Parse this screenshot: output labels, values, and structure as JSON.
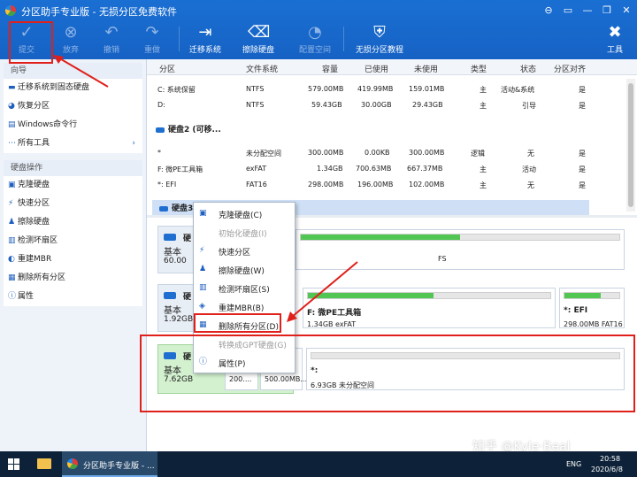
{
  "window": {
    "title": "分区助手专业版 - 无损分区免费软件",
    "controls": [
      "⊖",
      "▭",
      "—",
      "❐",
      "✕"
    ]
  },
  "toolbar": [
    {
      "label": "提交",
      "icon": "check-icon",
      "glyph": "✓",
      "enabled": false
    },
    {
      "label": "放弃",
      "icon": "discard-icon",
      "glyph": "⊗",
      "enabled": false
    },
    {
      "label": "撤销",
      "icon": "undo-icon",
      "glyph": "↶",
      "enabled": false
    },
    {
      "label": "重做",
      "icon": "redo-icon",
      "glyph": "↷",
      "enabled": false
    },
    {
      "label": "迁移系统",
      "icon": "migrate-icon",
      "glyph": "⇥",
      "enabled": true
    },
    {
      "label": "擦除硬盘",
      "icon": "wipe-disk-icon",
      "glyph": "⌫",
      "enabled": true
    },
    {
      "label": "配置空间",
      "icon": "allocate-space-icon",
      "glyph": "◔",
      "enabled": false
    },
    {
      "label": "无损分区教程",
      "icon": "shield-icon",
      "glyph": "⛨",
      "enabled": true
    },
    {
      "label": "工具",
      "icon": "tools-icon",
      "glyph": "✖",
      "enabled": true
    }
  ],
  "sidebar": {
    "wizard_header": "向导",
    "wizard_items": [
      {
        "label": "迁移系统到固态硬盘",
        "icon": "migrate-ssd-icon",
        "glyph": "▬"
      },
      {
        "label": "恢复分区",
        "icon": "recover-partition-icon",
        "glyph": "◕"
      },
      {
        "label": "Windows命令行",
        "icon": "cmd-icon",
        "glyph": "▤"
      },
      {
        "label": "所有工具",
        "icon": "more-icon",
        "glyph": "⋯"
      }
    ],
    "disk_ops_header": "硬盘操作",
    "disk_ops_items": [
      {
        "label": "克隆硬盘",
        "icon": "clone-disk-icon",
        "glyph": "▣"
      },
      {
        "label": "快速分区",
        "icon": "quick-partition-icon",
        "glyph": "⚡"
      },
      {
        "label": "擦除硬盘",
        "icon": "wipe-disk-icon",
        "glyph": "♟"
      },
      {
        "label": "检测坏扇区",
        "icon": "bad-sector-icon",
        "glyph": "▥"
      },
      {
        "label": "重建MBR",
        "icon": "rebuild-mbr-icon",
        "glyph": "◐"
      },
      {
        "label": "删除所有分区",
        "icon": "delete-all-icon",
        "glyph": "▦"
      },
      {
        "label": "属性",
        "icon": "info-icon",
        "glyph": "ⓘ"
      }
    ]
  },
  "table": {
    "headers": [
      "分区",
      "文件系统",
      "容量",
      "已使用",
      "未使用",
      "类型",
      "状态",
      "分区对齐"
    ],
    "disk1_rows": [
      [
        "C: 系统保留",
        "NTFS",
        "579.00MB",
        "419.99MB",
        "159.01MB",
        "主",
        "活动&系统",
        "是"
      ],
      [
        "D:",
        "NTFS",
        "59.43GB",
        "30.00GB",
        "29.43GB",
        "主",
        "引导",
        "是"
      ]
    ],
    "disk2_label": "硬盘2 (可移...",
    "disk2_rows": [
      [
        "*",
        "未分配空间",
        "300.00MB",
        "0.00KB",
        "300.00MB",
        "逻辑",
        "无",
        "是"
      ],
      [
        "F: 微PE工具箱",
        "exFAT",
        "1.34GB",
        "700.63MB",
        "667.37MB",
        "主",
        "活动",
        "是"
      ],
      [
        "*: EFI",
        "FAT16",
        "298.00MB",
        "196.00MB",
        "102.00MB",
        "主",
        "无",
        "是"
      ]
    ],
    "disk3_label": "硬盘3"
  },
  "disk_map": {
    "disk1": {
      "title": "硬",
      "line1": "基本 ",
      "line2": "60.00",
      "tail": "FS",
      "used": 0.5
    },
    "disk2": {
      "title": "硬",
      "line1": "基本 ",
      "line2": "1.92GB",
      "parts": [
        {
          "name": "F: 微PE工具箱",
          "size": "1.34GB exFAT",
          "used": 0.52
        },
        {
          "name": "*: EFI",
          "size": "298.00MB FAT16",
          "used": 0.66
        }
      ]
    },
    "disk3": {
      "title": "硬",
      "line1": "基本 ",
      "line2": "7.62GB",
      "parts": [
        {
          "name": "",
          "size": "200...."
        },
        {
          "name": "",
          "size": "500.00MB..."
        },
        {
          "name": "*:",
          "size": "6.93GB 未分配空间"
        }
      ]
    }
  },
  "context_menu": [
    {
      "label": "克隆硬盘(C)",
      "icon": "clone-disk-icon",
      "glyph": "▣",
      "enabled": true
    },
    {
      "label": "初始化硬盘(I)",
      "icon": "",
      "glyph": "",
      "enabled": false
    },
    {
      "label": "快速分区",
      "icon": "quick-partition-icon",
      "glyph": "⚡",
      "enabled": true
    },
    {
      "label": "擦除硬盘(W)",
      "icon": "wipe-disk-icon",
      "glyph": "♟",
      "enabled": true
    },
    {
      "label": "检测坏扇区(S)",
      "icon": "bad-sector-icon",
      "glyph": "▥",
      "enabled": true
    },
    {
      "label": "重建MBR(B)",
      "icon": "rebuild-mbr-icon",
      "glyph": "◈",
      "enabled": true
    },
    {
      "label": "删除所有分区(D)",
      "icon": "delete-all-icon",
      "glyph": "▦",
      "enabled": true
    },
    {
      "label": "转换成GPT硬盘(G)",
      "icon": "",
      "glyph": "",
      "enabled": false
    },
    {
      "label": "属性(P)",
      "icon": "info-icon",
      "glyph": "ⓘ",
      "enabled": true
    }
  ],
  "taskbar": {
    "app_label": "分区助手专业版 - ...",
    "lang": "ENG",
    "time": "20:58",
    "date": "2020/6/8"
  },
  "watermark": "知乎 @Kyle·Beal",
  "colors": {
    "accent": "#1a6fd3",
    "annotation": "#e0201b",
    "used_bar": "#52c652"
  }
}
